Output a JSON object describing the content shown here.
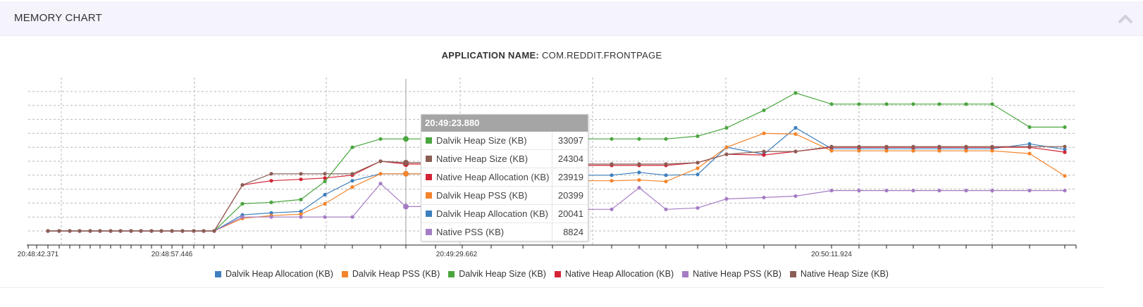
{
  "panel": {
    "title": "MEMORY CHART"
  },
  "app": {
    "label": "APPLICATION NAME:",
    "value": "COM.REDDIT.FRONTPAGE"
  },
  "tooltip": {
    "time": "20:49:23.880",
    "rows": [
      {
        "name": "Dalvik Heap Size (KB)",
        "value": "33097",
        "color": "#4aa63f"
      },
      {
        "name": "Native Heap Size (KB)",
        "value": "24304",
        "color": "#8b5e55"
      },
      {
        "name": "Native Heap Allocation (KB)",
        "value": "23919",
        "color": "#d32437"
      },
      {
        "name": "Dalvik Heap PSS (KB)",
        "value": "20399",
        "color": "#f4842b"
      },
      {
        "name": "Dalvik Heap Allocation (KB)",
        "value": "20041",
        "color": "#3d7fbd"
      },
      {
        "name": "Native PSS (KB)",
        "value": "8824",
        "color": "#a57cc4"
      }
    ]
  },
  "chart_data": {
    "type": "line",
    "title": "",
    "xlabel": "",
    "ylabel": "",
    "x_tick_labels": [
      "20:48:42.371",
      "20:48:57.446",
      "20:49:29.662",
      "20:50:11.924"
    ],
    "ylim": [
      0,
      40000
    ],
    "grid": true,
    "legend_position": "bottom",
    "x": [
      "20:48:42.4",
      "20:48:43.6",
      "20:48:44.8",
      "20:48:45.9",
      "20:48:47.1",
      "20:48:48.3",
      "20:48:49.4",
      "20:48:50.6",
      "20:48:51.8",
      "20:48:52.9",
      "20:48:54.1",
      "20:48:55.3",
      "20:48:56.4",
      "20:48:57.6",
      "20:48:58.8",
      "20:48:59.9",
      "20:49:01.1",
      "20:49:04.4",
      "20:49:07.6",
      "20:49:10.8",
      "20:49:14.1",
      "20:49:17.4",
      "20:49:20.6",
      "20:49:23.9",
      "20:49:27.1",
      "20:49:30.4",
      "20:49:33.6",
      "20:49:36.8",
      "20:49:40.1",
      "20:49:43.4",
      "20:49:46.6",
      "20:49:49.9",
      "20:49:53.1",
      "20:49:56.4",
      "20:49:59.6",
      "20:50:03.9",
      "20:50:08.2",
      "20:50:12.3",
      "20:50:15.4",
      "20:50:18.4",
      "20:50:21.5",
      "20:50:24.6",
      "20:50:27.6",
      "20:50:30.6",
      "20:50:35.0",
      "20:50:39.4"
    ],
    "series": [
      {
        "name": "Dalvik Heap Allocation (KB)",
        "color": "#3d7fbd",
        "values": [
          0,
          0,
          0,
          0,
          0,
          0,
          0,
          0,
          0,
          0,
          0,
          0,
          0,
          0,
          0,
          0,
          0,
          4600,
          5200,
          5600,
          10400,
          14400,
          16400,
          16400,
          16400,
          16400,
          16400,
          16000,
          16000,
          16000,
          16000,
          16800,
          16000,
          16200,
          24000,
          22000,
          29600,
          23600,
          23600,
          23600,
          23600,
          23600,
          23600,
          23600,
          25000,
          23400
        ]
      },
      {
        "name": "Dalvik Heap PSS (KB)",
        "color": "#f4842b",
        "values": [
          0,
          0,
          0,
          0,
          0,
          0,
          0,
          0,
          0,
          0,
          0,
          0,
          0,
          0,
          0,
          0,
          0,
          3600,
          4400,
          4800,
          7800,
          12600,
          16400,
          16400,
          16400,
          16400,
          16400,
          14400,
          14400,
          14400,
          14400,
          14600,
          14200,
          18000,
          24000,
          28000,
          27800,
          23000,
          23000,
          23000,
          23000,
          23000,
          23000,
          23000,
          22200,
          15800
        ]
      },
      {
        "name": "Dalvik Heap Size (KB)",
        "color": "#4aa63f",
        "values": [
          0,
          0,
          0,
          0,
          0,
          0,
          0,
          0,
          0,
          0,
          0,
          0,
          0,
          0,
          0,
          0,
          0,
          7800,
          8200,
          9000,
          14200,
          24000,
          26400,
          26400,
          26400,
          26400,
          26400,
          26400,
          26400,
          26400,
          26400,
          26400,
          26400,
          27200,
          29600,
          34600,
          39600,
          36400,
          36400,
          36400,
          36400,
          36400,
          36400,
          36400,
          29800,
          29800
        ]
      },
      {
        "name": "Native Heap Allocation (KB)",
        "color": "#d32437",
        "values": [
          0,
          0,
          0,
          0,
          0,
          0,
          0,
          0,
          0,
          0,
          0,
          0,
          0,
          0,
          0,
          0,
          0,
          13200,
          14400,
          14800,
          15200,
          16000,
          20000,
          19200,
          19200,
          19200,
          19200,
          18800,
          18800,
          18800,
          18800,
          18800,
          18800,
          19600,
          22000,
          21800,
          22800,
          24000,
          24000,
          24000,
          24000,
          24000,
          24000,
          24000,
          24000,
          22600
        ]
      },
      {
        "name": "Native Heap PSS (KB)",
        "color": "#a57cc4",
        "values": [
          0,
          0,
          0,
          0,
          0,
          0,
          0,
          0,
          0,
          0,
          0,
          0,
          0,
          0,
          0,
          0,
          0,
          4000,
          4000,
          4000,
          4000,
          4000,
          13600,
          7000,
          7000,
          7000,
          7000,
          6200,
          6200,
          6200,
          6200,
          12400,
          6200,
          6600,
          9200,
          9600,
          10000,
          11600,
          11600,
          11600,
          11600,
          11600,
          11600,
          11600,
          11600,
          11600
        ]
      },
      {
        "name": "Native Heap Size (KB)",
        "color": "#8b5e55",
        "values": [
          0,
          0,
          0,
          0,
          0,
          0,
          0,
          0,
          0,
          0,
          0,
          0,
          0,
          0,
          0,
          0,
          0,
          13200,
          16400,
          16400,
          16400,
          16400,
          20000,
          19600,
          19600,
          19600,
          19600,
          19200,
          19200,
          19200,
          19200,
          19200,
          19200,
          19600,
          22000,
          22800,
          22800,
          24200,
          24200,
          24200,
          24200,
          24200,
          24200,
          24200,
          24200,
          24200
        ]
      }
    ]
  }
}
